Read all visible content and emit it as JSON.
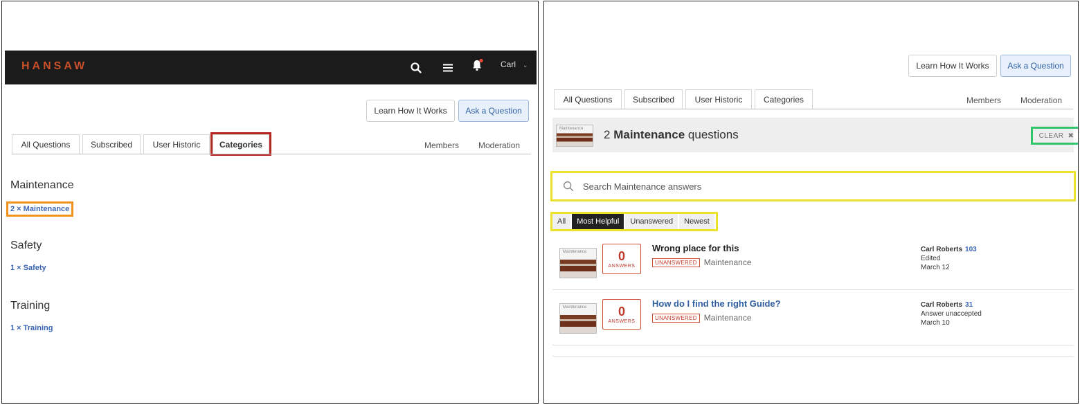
{
  "left": {
    "topbar": {
      "logo": "HANSAW",
      "user_name": "Carl",
      "user_chevron": "⌄",
      "icons": [
        "search-icon",
        "menu-icon",
        "bell-icon"
      ],
      "notification_dot_color": "#e74c3c"
    },
    "actions": {
      "learn_label": "Learn How It Works",
      "ask_label": "Ask a Question"
    },
    "tabs": [
      "All Questions",
      "Subscribed",
      "User Historic",
      "Categories"
    ],
    "active_tab": "Categories",
    "side_tabs": [
      "Members",
      "Moderation"
    ],
    "categories": [
      {
        "title": "Maintenance",
        "link": "2 × Maintenance"
      },
      {
        "title": "Safety",
        "link": "1 × Safety"
      },
      {
        "title": "Training",
        "link": "1 × Training"
      }
    ]
  },
  "right": {
    "actions": {
      "learn_label": "Learn How It Works",
      "ask_label": "Ask a Question"
    },
    "tabs": [
      "All Questions",
      "Subscribed",
      "User Historic",
      "Categories"
    ],
    "side_tabs": [
      "Members",
      "Moderation"
    ],
    "banner": {
      "thumb_label": "Maintenance",
      "count": "2",
      "category": "Maintenance",
      "suffix": "questions",
      "clear_label": "CLEAR",
      "clear_icon": "✖"
    },
    "search": {
      "placeholder": "Search Maintenance answers"
    },
    "filters": [
      "All",
      "Most Helpful",
      "Unanswered",
      "Newest"
    ],
    "active_filter": "Most Helpful",
    "questions": [
      {
        "thumb_label": "Maintenance",
        "answers": "0",
        "answers_label": "ANSWERS",
        "title": "Wrong place for this",
        "status": "UNANSWERED",
        "category": "Maintenance",
        "author": "Carl Roberts",
        "rep": "103",
        "action": "Edited",
        "date": "March 12"
      },
      {
        "thumb_label": "Maintenance",
        "answers": "0",
        "answers_label": "ANSWERS",
        "title": "How do I find the right Guide?",
        "status": "UNANSWERED",
        "category": "Maintenance",
        "author": "Carl Roberts",
        "rep": "31",
        "action": "Answer unaccepted",
        "date": "March 10"
      }
    ]
  },
  "colors": {
    "link": "#3a66b5",
    "accent_orange": "#c8502a",
    "highlight_red": "#b3261e",
    "highlight_orange": "#f0921c",
    "highlight_yellow": "#ece12c",
    "highlight_green": "#2fc56a"
  }
}
